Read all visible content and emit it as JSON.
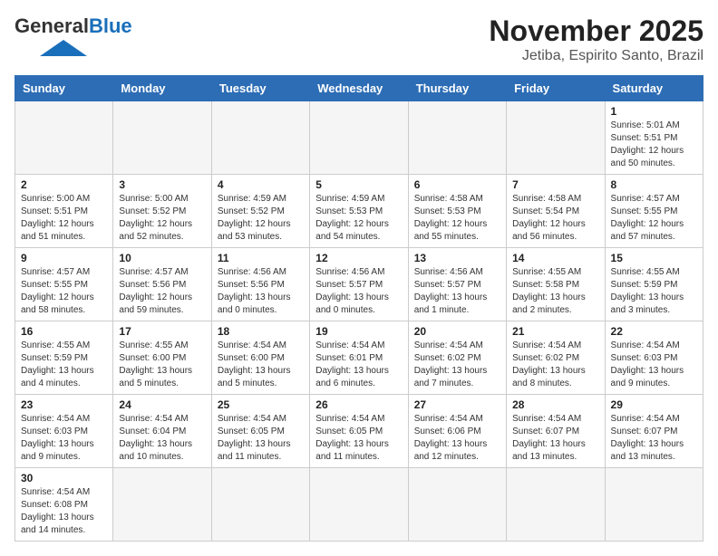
{
  "header": {
    "logo_general": "General",
    "logo_blue": "Blue",
    "title": "November 2025",
    "subtitle": "Jetiba, Espirito Santo, Brazil"
  },
  "weekdays": [
    "Sunday",
    "Monday",
    "Tuesday",
    "Wednesday",
    "Thursday",
    "Friday",
    "Saturday"
  ],
  "days": [
    {
      "num": "",
      "info": ""
    },
    {
      "num": "",
      "info": ""
    },
    {
      "num": "",
      "info": ""
    },
    {
      "num": "",
      "info": ""
    },
    {
      "num": "",
      "info": ""
    },
    {
      "num": "",
      "info": ""
    },
    {
      "num": "1",
      "info": "Sunrise: 5:01 AM\nSunset: 5:51 PM\nDaylight: 12 hours\nand 50 minutes."
    },
    {
      "num": "2",
      "info": "Sunrise: 5:00 AM\nSunset: 5:51 PM\nDaylight: 12 hours\nand 51 minutes."
    },
    {
      "num": "3",
      "info": "Sunrise: 5:00 AM\nSunset: 5:52 PM\nDaylight: 12 hours\nand 52 minutes."
    },
    {
      "num": "4",
      "info": "Sunrise: 4:59 AM\nSunset: 5:52 PM\nDaylight: 12 hours\nand 53 minutes."
    },
    {
      "num": "5",
      "info": "Sunrise: 4:59 AM\nSunset: 5:53 PM\nDaylight: 12 hours\nand 54 minutes."
    },
    {
      "num": "6",
      "info": "Sunrise: 4:58 AM\nSunset: 5:53 PM\nDaylight: 12 hours\nand 55 minutes."
    },
    {
      "num": "7",
      "info": "Sunrise: 4:58 AM\nSunset: 5:54 PM\nDaylight: 12 hours\nand 56 minutes."
    },
    {
      "num": "8",
      "info": "Sunrise: 4:57 AM\nSunset: 5:55 PM\nDaylight: 12 hours\nand 57 minutes."
    },
    {
      "num": "9",
      "info": "Sunrise: 4:57 AM\nSunset: 5:55 PM\nDaylight: 12 hours\nand 58 minutes."
    },
    {
      "num": "10",
      "info": "Sunrise: 4:57 AM\nSunset: 5:56 PM\nDaylight: 12 hours\nand 59 minutes."
    },
    {
      "num": "11",
      "info": "Sunrise: 4:56 AM\nSunset: 5:56 PM\nDaylight: 13 hours\nand 0 minutes."
    },
    {
      "num": "12",
      "info": "Sunrise: 4:56 AM\nSunset: 5:57 PM\nDaylight: 13 hours\nand 0 minutes."
    },
    {
      "num": "13",
      "info": "Sunrise: 4:56 AM\nSunset: 5:57 PM\nDaylight: 13 hours\nand 1 minute."
    },
    {
      "num": "14",
      "info": "Sunrise: 4:55 AM\nSunset: 5:58 PM\nDaylight: 13 hours\nand 2 minutes."
    },
    {
      "num": "15",
      "info": "Sunrise: 4:55 AM\nSunset: 5:59 PM\nDaylight: 13 hours\nand 3 minutes."
    },
    {
      "num": "16",
      "info": "Sunrise: 4:55 AM\nSunset: 5:59 PM\nDaylight: 13 hours\nand 4 minutes."
    },
    {
      "num": "17",
      "info": "Sunrise: 4:55 AM\nSunset: 6:00 PM\nDaylight: 13 hours\nand 5 minutes."
    },
    {
      "num": "18",
      "info": "Sunrise: 4:54 AM\nSunset: 6:00 PM\nDaylight: 13 hours\nand 5 minutes."
    },
    {
      "num": "19",
      "info": "Sunrise: 4:54 AM\nSunset: 6:01 PM\nDaylight: 13 hours\nand 6 minutes."
    },
    {
      "num": "20",
      "info": "Sunrise: 4:54 AM\nSunset: 6:02 PM\nDaylight: 13 hours\nand 7 minutes."
    },
    {
      "num": "21",
      "info": "Sunrise: 4:54 AM\nSunset: 6:02 PM\nDaylight: 13 hours\nand 8 minutes."
    },
    {
      "num": "22",
      "info": "Sunrise: 4:54 AM\nSunset: 6:03 PM\nDaylight: 13 hours\nand 9 minutes."
    },
    {
      "num": "23",
      "info": "Sunrise: 4:54 AM\nSunset: 6:03 PM\nDaylight: 13 hours\nand 9 minutes."
    },
    {
      "num": "24",
      "info": "Sunrise: 4:54 AM\nSunset: 6:04 PM\nDaylight: 13 hours\nand 10 minutes."
    },
    {
      "num": "25",
      "info": "Sunrise: 4:54 AM\nSunset: 6:05 PM\nDaylight: 13 hours\nand 11 minutes."
    },
    {
      "num": "26",
      "info": "Sunrise: 4:54 AM\nSunset: 6:05 PM\nDaylight: 13 hours\nand 11 minutes."
    },
    {
      "num": "27",
      "info": "Sunrise: 4:54 AM\nSunset: 6:06 PM\nDaylight: 13 hours\nand 12 minutes."
    },
    {
      "num": "28",
      "info": "Sunrise: 4:54 AM\nSunset: 6:07 PM\nDaylight: 13 hours\nand 13 minutes."
    },
    {
      "num": "29",
      "info": "Sunrise: 4:54 AM\nSunset: 6:07 PM\nDaylight: 13 hours\nand 13 minutes."
    },
    {
      "num": "30",
      "info": "Sunrise: 4:54 AM\nSunset: 6:08 PM\nDaylight: 13 hours\nand 14 minutes."
    },
    {
      "num": "",
      "info": ""
    },
    {
      "num": "",
      "info": ""
    },
    {
      "num": "",
      "info": ""
    },
    {
      "num": "",
      "info": ""
    },
    {
      "num": "",
      "info": ""
    },
    {
      "num": "",
      "info": ""
    }
  ]
}
